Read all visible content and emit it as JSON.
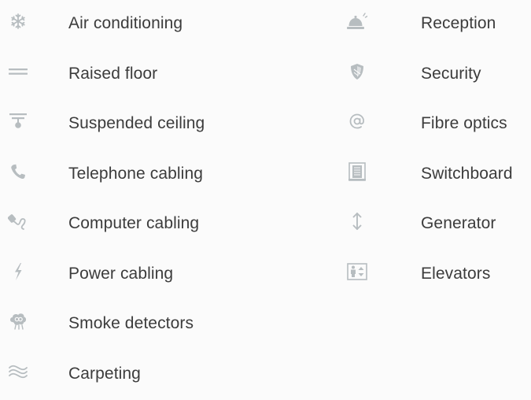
{
  "amenities_left": [
    {
      "label": "Air conditioning",
      "icon": "snowflake-icon"
    },
    {
      "label": "Raised floor",
      "icon": "raised-floor-icon"
    },
    {
      "label": "Suspended ceiling",
      "icon": "ceiling-lamp-icon"
    },
    {
      "label": "Telephone cabling",
      "icon": "phone-icon"
    },
    {
      "label": "Computer cabling",
      "icon": "computer-cable-icon"
    },
    {
      "label": "Power cabling",
      "icon": "lightning-icon"
    },
    {
      "label": "Smoke detectors",
      "icon": "smoke-detector-icon"
    },
    {
      "label": "Carpeting",
      "icon": "carpet-waves-icon"
    }
  ],
  "amenities_right": [
    {
      "label": "Reception",
      "icon": "reception-bell-icon"
    },
    {
      "label": "Security",
      "icon": "shield-icon"
    },
    {
      "label": "Fibre optics",
      "icon": "at-sign-icon"
    },
    {
      "label": "Switchboard",
      "icon": "switchboard-icon"
    },
    {
      "label": "Generator",
      "icon": "vertical-arrows-icon"
    },
    {
      "label": "Elevators",
      "icon": "elevator-icon"
    }
  ],
  "colors": {
    "icon": "#b7bdc0",
    "text": "#3c3c3c",
    "background": "#fbfbfb"
  }
}
